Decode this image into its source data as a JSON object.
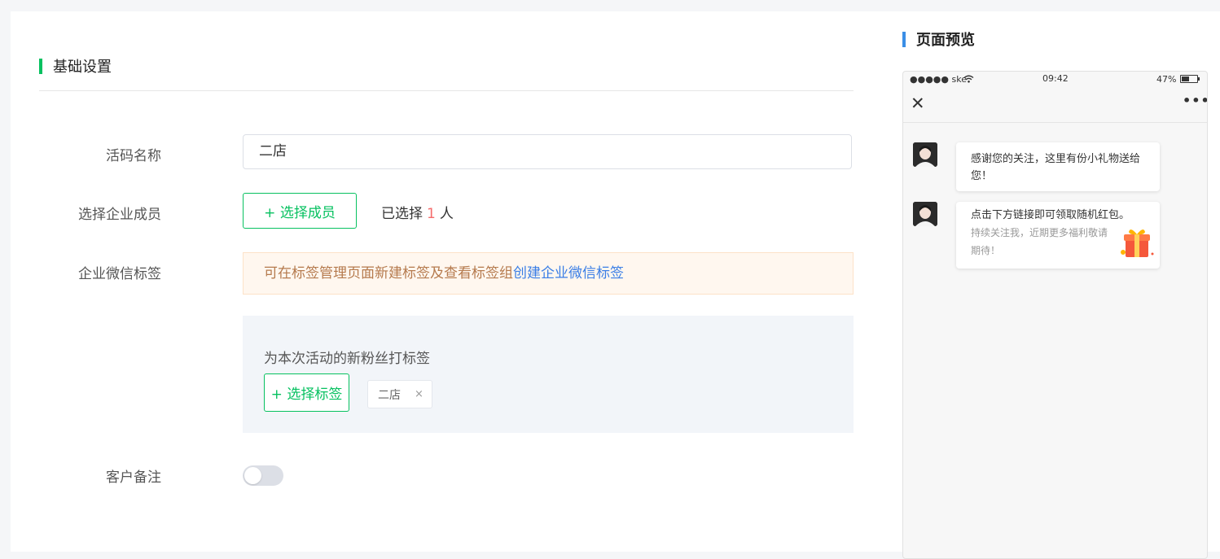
{
  "form": {
    "section_title": "基础设置",
    "name_label": "活码名称",
    "name_value": "二店",
    "member_label": "选择企业成员",
    "select_member_button": "+ 选择成员",
    "selected_prefix": "已选择",
    "selected_count": "1",
    "selected_suffix": "人",
    "tag_label": "企业微信标签",
    "notice_text": "可在标签管理页面新建标签及查看标签组",
    "notice_link": "创建企业微信标签",
    "tag_box_title": "为本次活动的新粉丝打标签",
    "select_tag_button": "+ 选择标签",
    "tags": [
      {
        "label": "二店",
        "close": "×"
      }
    ],
    "remark_label": "客户备注",
    "remark_enabled": false
  },
  "preview": {
    "title": "页面预览",
    "status_bar": {
      "carrier": "●●●●● ske",
      "time": "09:42",
      "battery": "47%"
    },
    "nav": {
      "close": "✕",
      "more": "•••"
    },
    "messages": [
      {
        "text": "感谢您的关注，这里有份小礼物送给您！"
      },
      {
        "text": "点击下方链接即可领取随机红包。",
        "sub": "持续关注我，近期更多福利敬请期待！"
      }
    ]
  },
  "colors": {
    "accent_green": "#07c160",
    "accent_blue": "#3a8ee6",
    "count_red": "#f56c6c",
    "link_blue": "#3a7ee6",
    "notice_text": "#b57a4d"
  }
}
